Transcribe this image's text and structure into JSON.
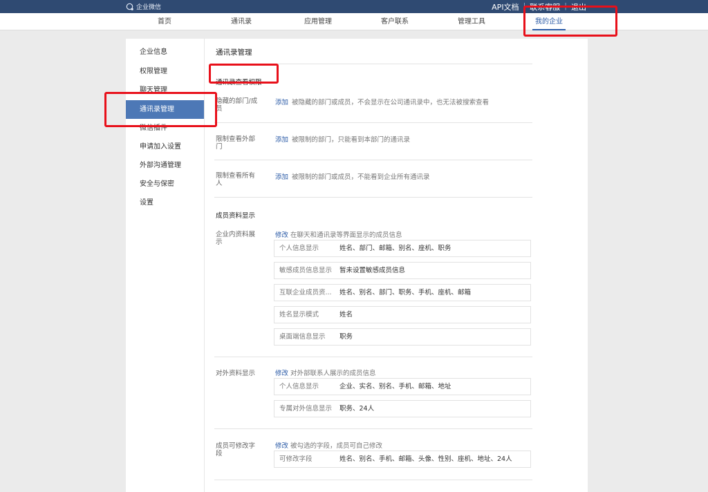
{
  "header": {
    "brand": "企业微信",
    "api_doc": "API文档",
    "contact": "联系客服",
    "logout": "退出",
    "separator": "|"
  },
  "nav": {
    "items": [
      "首页",
      "通讯录",
      "应用管理",
      "客户联系",
      "管理工具",
      "我的企业"
    ],
    "active": "我的企业"
  },
  "sidebar": {
    "items": [
      "企业信息",
      "权限管理",
      "聊天管理",
      "通讯录管理",
      "微信插件",
      "申请加入设置",
      "外部沟通管理",
      "安全与保密",
      "设置"
    ],
    "active": "通讯录管理"
  },
  "content": {
    "title": "通讯录管理",
    "view_permission": {
      "title": "通讯录查看权限",
      "rows": [
        {
          "label": "隐藏的部门/成员",
          "action": "添加",
          "desc": "被隐藏的部门或成员，不会显示在公司通讯录中，也无法被搜索查看"
        },
        {
          "label": "限制查看外部门",
          "action": "添加",
          "desc": "被限制的部门，只能看到本部门的通讯录"
        },
        {
          "label": "限制查看所有人",
          "action": "添加",
          "desc": "被限制的部门或成员，不能看到企业所有通讯录"
        }
      ]
    },
    "member_display": {
      "title": "成员资料显示",
      "internal": {
        "label": "企业内资料展示",
        "action": "修改",
        "desc": "在聊天和通讯录等界面显示的成员信息",
        "fields": [
          {
            "name": "个人信息显示",
            "value": "姓名、部门、邮箱、别名、座机、职务"
          },
          {
            "name": "敏感成员信息显示",
            "value": "暂未设置敏感成员信息"
          },
          {
            "name": "互联企业成员资...",
            "value": "姓名、别名、部门、职务、手机、座机、邮箱"
          },
          {
            "name": "姓名显示模式",
            "value": "姓名"
          },
          {
            "name": "桌面端信息显示",
            "value": "职务"
          }
        ]
      },
      "external": {
        "label": "对外资料显示",
        "action": "修改",
        "desc": "对外部联系人展示的成员信息",
        "fields": [
          {
            "name": "个人信息显示",
            "value": "企业、实名、别名、手机、邮箱、地址"
          },
          {
            "name": "专属对外信息显示",
            "value": "职务、24人"
          }
        ]
      },
      "editable": {
        "label": "成员可修改字段",
        "action": "修改",
        "desc": "被勾选的字段，成员可自己修改",
        "fields": [
          {
            "name": "可修改字段",
            "value": "姓名、别名、手机、邮箱、头像、性别、座机、地址、24人"
          }
        ]
      }
    }
  },
  "colors": {
    "header_bg": "#2f4a72",
    "accent": "#2a5aa6",
    "sidebar_active": "#4d78b6",
    "annotation_red": "#e8101a"
  }
}
